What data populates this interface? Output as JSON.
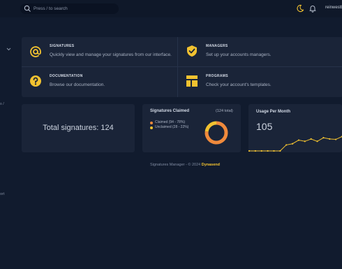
{
  "topbar": {
    "search_placeholder": "Press / to search",
    "username": "reinwestbr",
    "icons": [
      "search-icon",
      "moon-icon",
      "bell-icon"
    ]
  },
  "sidebar": {
    "fragments": [
      "s /",
      "ort"
    ]
  },
  "tiles": [
    {
      "title": "SIGNATURES",
      "desc": "Quickly view and manage your signatures from our interface.",
      "icon": "at-icon"
    },
    {
      "title": "MANAGERS",
      "desc": "Set up your accounts managers.",
      "icon": "shield-check-icon"
    },
    {
      "title": "DOCUMENTATION",
      "desc": "Browse our documentation.",
      "icon": "help-icon"
    },
    {
      "title": "PROGRAMS",
      "desc": "Check your account's templates.",
      "icon": "template-icon"
    }
  ],
  "total_card": {
    "text": "Total  signatures: 124"
  },
  "claimed_card": {
    "title": "Signatures Claimed",
    "total": "(124 total)",
    "legend": [
      {
        "label": "Claimed (94 - 78%)",
        "color": "#f08a3c"
      },
      {
        "label": "Unclaimed (28 - 22%)",
        "color": "#f2c230"
      }
    ]
  },
  "usage_card": {
    "title": "Usage Per Month",
    "value": "105"
  },
  "footer": {
    "text": "Signatures Manager - © 2024 ",
    "brand": "Dynasend"
  },
  "colors": {
    "accent": "#f2c230",
    "orange": "#f08a3c",
    "background": "#111b2e",
    "card": "#1a2438"
  },
  "chart_data": [
    {
      "type": "pie",
      "title": "Signatures Claimed",
      "categories": [
        "Claimed (94 - 78%)",
        "Unclaimed (28 - 22%)"
      ],
      "values": [
        94,
        28
      ]
    },
    {
      "type": "line",
      "title": "Usage Per Month",
      "x": [
        1,
        2,
        3,
        4,
        5,
        6,
        7,
        8,
        9,
        10,
        11,
        12,
        13,
        14,
        15,
        16
      ],
      "y": [
        0,
        0,
        0,
        0,
        0,
        0,
        25,
        30,
        45,
        40,
        50,
        40,
        55,
        50,
        48,
        60
      ],
      "color": "#f2c230",
      "grid": false,
      "legend": "none"
    }
  ]
}
